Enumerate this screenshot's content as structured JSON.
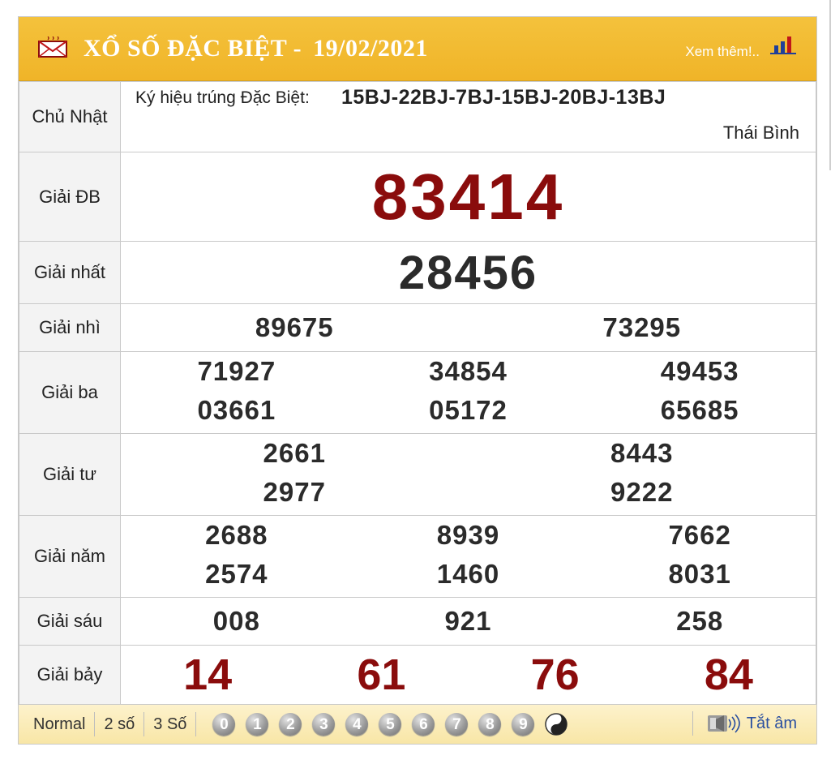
{
  "header": {
    "title": "XỔ SỐ ĐẶC BIỆT -",
    "date": "19/02/2021",
    "more_link": "Xem thêm!..",
    "mail_icon": "envelope-icon",
    "chart_icon": "bar-chart-icon"
  },
  "info": {
    "weekday": "Chủ Nhật",
    "symbol_label": "Ký hiệu trúng Đặc Biệt:",
    "symbol_value": "15BJ-22BJ-7BJ-15BJ-20BJ-13BJ",
    "province": "Thái Bình"
  },
  "prizes": {
    "db": {
      "label": "Giải ĐB",
      "numbers": [
        "83414"
      ]
    },
    "g1": {
      "label": "Giải nhất",
      "numbers": [
        "28456"
      ]
    },
    "g2": {
      "label": "Giải nhì",
      "numbers": [
        "89675",
        "73295"
      ]
    },
    "g3": {
      "label": "Giải ba",
      "numbers": [
        "71927",
        "34854",
        "49453",
        "03661",
        "05172",
        "65685"
      ]
    },
    "g4": {
      "label": "Giải tư",
      "numbers": [
        "2661",
        "8443",
        "2977",
        "9222"
      ]
    },
    "g5": {
      "label": "Giải năm",
      "numbers": [
        "2688",
        "8939",
        "7662",
        "2574",
        "1460",
        "8031"
      ]
    },
    "g6": {
      "label": "Giải sáu",
      "numbers": [
        "008",
        "921",
        "258"
      ]
    },
    "g7": {
      "label": "Giải bảy",
      "numbers": [
        "14",
        "61",
        "76",
        "84"
      ]
    }
  },
  "footer": {
    "options": [
      "Normal",
      "2 số",
      "3 Số"
    ],
    "digits": [
      "0",
      "1",
      "2",
      "3",
      "4",
      "5",
      "6",
      "7",
      "8",
      "9"
    ],
    "yin_yang_icon": "yin-yang-icon",
    "sound_icon": "speaker-icon",
    "mute_label": "Tắt âm"
  },
  "colors": {
    "header_bg": "#f0b428",
    "special_number": "#8a0c0c",
    "number": "#2b2b2b",
    "footer_bg": "#f8e6a6",
    "mute_link": "#2a4fa0"
  }
}
